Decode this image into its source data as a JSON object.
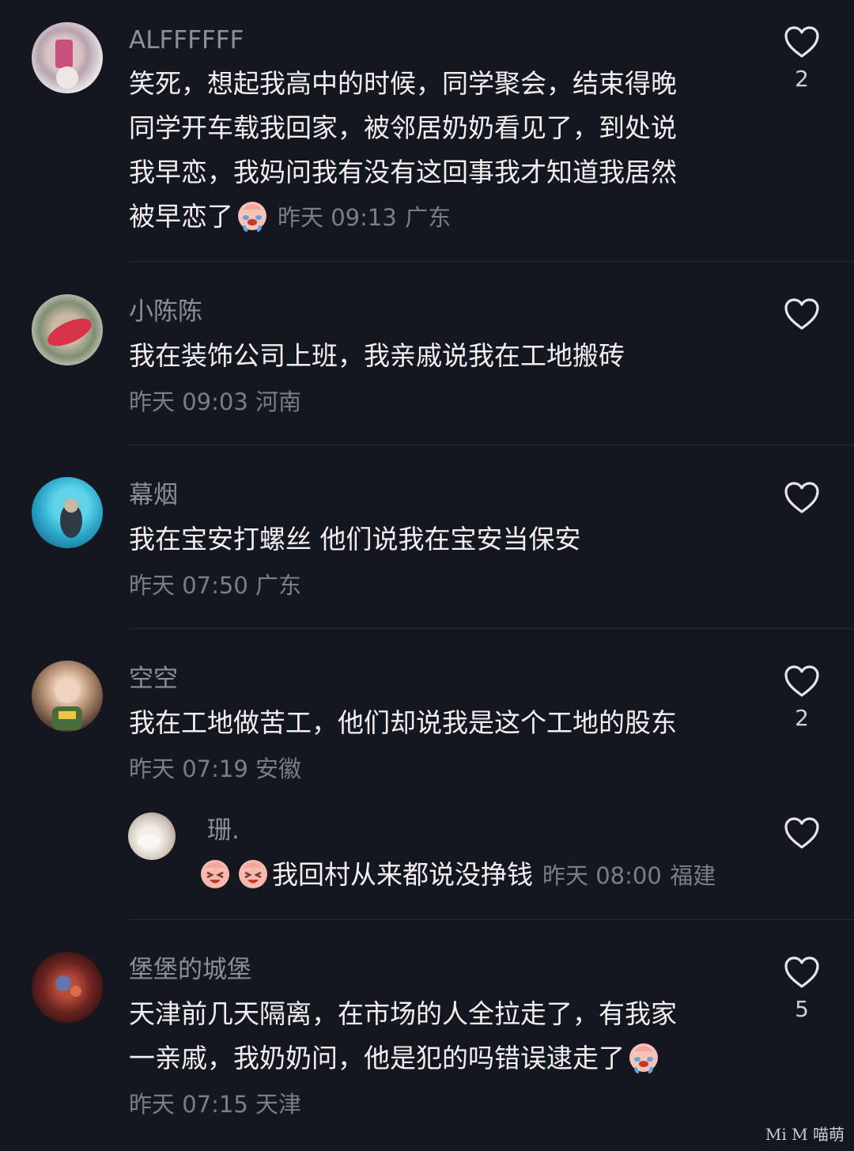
{
  "comments": [
    {
      "username": "ALFFFFFF",
      "lines": [
        "笑死，想起我高中的时候，同学聚会，结束得晚",
        "同学开车载我回家，被邻居奶奶看见了，到处说",
        "我早恋，我妈问我有没有这回事我才知道我居然",
        "被早恋了"
      ],
      "time": "昨天 09:13",
      "region": "广东",
      "likes": "2",
      "emoji": "crying-face"
    },
    {
      "username": "小陈陈",
      "lines": [
        "我在装饰公司上班，我亲戚说我在工地搬砖"
      ],
      "time": "昨天 09:03",
      "region": "河南",
      "likes": ""
    },
    {
      "username": "幕烟",
      "lines": [
        "我在宝安打螺丝 他们说我在宝安当保安"
      ],
      "time": "昨天 07:50",
      "region": "广东",
      "likes": ""
    },
    {
      "username": "空空",
      "lines": [
        "我在工地做苦工，他们却说我是这个工地的股东"
      ],
      "time": "昨天 07:19",
      "region": "安徽",
      "likes": "2",
      "reply": {
        "username": "珊.",
        "text": "我回村从来都说没挣钱",
        "time": "昨天 08:00",
        "region": "福建",
        "likes": ""
      }
    },
    {
      "username": "堡堡的城堡",
      "lines": [
        "天津前几天隔离，在市场的人全拉走了，有我家",
        "一亲戚，我奶奶问，他是犯的吗错误逮走了"
      ],
      "time": "昨天 07:15",
      "region": "天津",
      "likes": "5",
      "emoji": "crying-face"
    }
  ],
  "watermark": "Mi M 喵萌",
  "icons": {
    "like": "heart-outline-icon",
    "emoji": "crying-face-emoji"
  },
  "colors": {
    "background": "#161620",
    "username": "#8e8e97",
    "text": "#f0f0f4",
    "meta": "#7d7d86"
  }
}
